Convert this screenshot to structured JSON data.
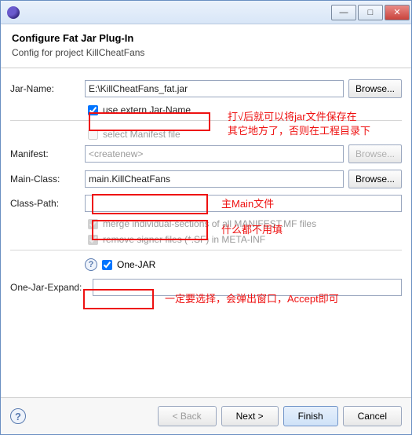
{
  "window": {
    "min": "—",
    "max": "□",
    "close": "✕"
  },
  "header": {
    "title": "Configure Fat Jar Plug-In",
    "subtitle": "Config for project KillCheatFans"
  },
  "labels": {
    "jarName": "Jar-Name:",
    "manifest": "Manifest:",
    "mainClass": "Main-Class:",
    "classPath": "Class-Path:",
    "oneJarExpand": "One-Jar-Expand:"
  },
  "fields": {
    "jarName": "E:\\KillCheatFans_fat.jar",
    "manifest": "<createnew>",
    "mainClass": "main.KillCheatFans",
    "classPath": "",
    "oneJarExpand": ""
  },
  "checkboxes": {
    "externJar": "use extern Jar-Name",
    "selectManifest": "select Manifest file",
    "mergeSections": "merge individual-sections of all MANIFEST.MF files",
    "removeSigner": "remove signer files (*.SF) in META-INF",
    "oneJar": "One-JAR"
  },
  "buttons": {
    "browse": "Browse...",
    "back": "< Back",
    "next": "Next >",
    "finish": "Finish",
    "cancel": "Cancel"
  },
  "annotations": {
    "jarNote1": "打√后就可以将jar文件保存在",
    "jarNote2": "其它地方了，否则在工程目录下",
    "mainNote": "主Main文件",
    "classPathNote": "什么都不用填",
    "oneJarNote": "一定要选择，会弹出窗口，Accept即可"
  }
}
